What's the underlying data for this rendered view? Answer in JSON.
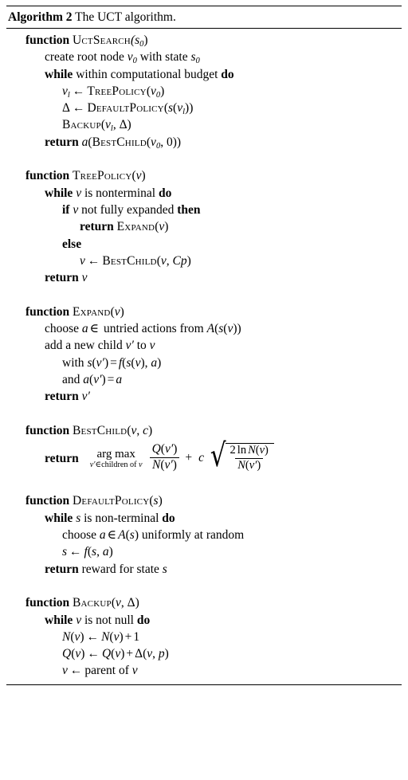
{
  "caption": {
    "label": "Algorithm",
    "number": "2",
    "title": "The UCT algorithm."
  },
  "lines": {
    "f1_header_kw": "function",
    "f1_header_name": "UctSearch",
    "f1_header_args": "(s",
    "f1_header_sub": "0",
    "f1_header_close": ")",
    "f1_l1_a": "create root node ",
    "f1_l1_v": "v",
    "f1_l1_vsub": "0",
    "f1_l1_b": " with state ",
    "f1_l1_s": "s",
    "f1_l1_ssub": "0",
    "f1_l2_kw1": "while",
    "f1_l2_text": "within computational budget",
    "f1_l2_kw2": "do",
    "f1_l3_v": "v",
    "f1_l3_vsub": "l",
    "f1_l3_arrow": "←",
    "f1_l3_call": "TreePolicy",
    "f1_l3_open": "(",
    "f1_l3_arg": "v",
    "f1_l3_argsub": "0",
    "f1_l3_close": ")",
    "f1_l4_delta": "Δ",
    "f1_l4_arrow": "←",
    "f1_l4_call": "DefaultPolicy",
    "f1_l4_open": "(",
    "f1_l4_s": "s",
    "f1_l4_open2": "(",
    "f1_l4_v": "v",
    "f1_l4_vsub": "l",
    "f1_l4_close": "))",
    "f1_l5_call": "Backup",
    "f1_l5_open": "(",
    "f1_l5_v": "v",
    "f1_l5_vsub": "l",
    "f1_l5_comma": ", ",
    "f1_l5_delta": "Δ",
    "f1_l5_close": ")",
    "f1_l6_kw": "return",
    "f1_l6_a": "a",
    "f1_l6_open": "(",
    "f1_l6_call": "BestChild",
    "f1_l6_open2": "(",
    "f1_l6_v": "v",
    "f1_l6_vsub": "0",
    "f1_l6_comma": ", ",
    "f1_l6_zero": "0",
    "f1_l6_close": "))",
    "f2_header_kw": "function",
    "f2_header_name": "TreePolicy",
    "f2_header_open": "(",
    "f2_header_v": "v",
    "f2_header_close": ")",
    "f2_l1_kw1": "while",
    "f2_l1_v": "v",
    "f2_l1_text": "is nonterminal",
    "f2_l1_kw2": "do",
    "f2_l2_kw1": "if",
    "f2_l2_v": "v",
    "f2_l2_text": "not fully expanded",
    "f2_l2_kw2": "then",
    "f2_l3_kw": "return",
    "f2_l3_call": "Expand",
    "f2_l3_open": "(",
    "f2_l3_v": "v",
    "f2_l3_close": ")",
    "f2_l4_kw": "else",
    "f2_l5_v": "v",
    "f2_l5_arrow": "←",
    "f2_l5_call": "BestChild",
    "f2_l5_open": "(",
    "f2_l5_arg1": "v",
    "f2_l5_comma": ", ",
    "f2_l5_arg2": "Cp",
    "f2_l5_close": ")",
    "f2_l6_kw": "return",
    "f2_l6_v": "v",
    "f3_header_kw": "function",
    "f3_header_name": "Expand",
    "f3_header_open": "(",
    "f3_header_v": "v",
    "f3_header_close": ")",
    "f3_l1_a": "choose ",
    "f3_l1_var": "a",
    "f3_l1_in": "∈",
    "f3_l1_b": " untried actions from ",
    "f3_l1_A": "A",
    "f3_l1_open": "(",
    "f3_l1_s": "s",
    "f3_l1_open2": "(",
    "f3_l1_v": "v",
    "f3_l1_close": "))",
    "f3_l2_a": "add a new child ",
    "f3_l2_vp": "v′",
    "f3_l2_b": " to ",
    "f3_l2_v": "v",
    "f3_l3_kw": "with ",
    "f3_l3_s": "s",
    "f3_l3_open": "(",
    "f3_l3_vp": "v′",
    "f3_l3_close": ")",
    "f3_l3_eq": "=",
    "f3_l3_f": "f",
    "f3_l3_open2": "(",
    "f3_l3_s2": "s",
    "f3_l3_open3": "(",
    "f3_l3_v": "v",
    "f3_l3_close2": ")",
    "f3_l3_comma": ", ",
    "f3_l3_a": "a",
    "f3_l3_close3": ")",
    "f3_l4_kw": "and  ",
    "f3_l4_a": "a",
    "f3_l4_open": "(",
    "f3_l4_vp": "v′",
    "f3_l4_close": ")",
    "f3_l4_eq": "=",
    "f3_l4_a2": "a",
    "f3_l5_kw": "return",
    "f3_l5_vp": "v′",
    "f4_header_kw": "function",
    "f4_header_name": "BestChild",
    "f4_header_open": "(",
    "f4_header_v": "v",
    "f4_header_comma": ", ",
    "f4_header_c": "c",
    "f4_header_close": ")",
    "f4_return_kw": "return",
    "f4_argmax_top": "arg max",
    "f4_argmax_bot_vp": "v′",
    "f4_argmax_bot_in": "∈",
    "f4_argmax_bot_text": "children of ",
    "f4_argmax_bot_v": "v",
    "f4_frac1_num_Q": "Q",
    "f4_frac1_num_open": "(",
    "f4_frac1_num_vp": "v′",
    "f4_frac1_num_close": ")",
    "f4_frac1_den_N": "N",
    "f4_frac1_den_open": "(",
    "f4_frac1_den_vp": "v′",
    "f4_frac1_den_close": ")",
    "f4_plus": "+",
    "f4_c": "c",
    "f4_sqrt_glyph": "√",
    "f4_frac2_num_2": "2",
    "f4_frac2_num_ln": "ln",
    "f4_frac2_num_N": "N",
    "f4_frac2_num_open": "(",
    "f4_frac2_num_v": "v",
    "f4_frac2_num_close": ")",
    "f4_frac2_den_N": "N",
    "f4_frac2_den_open": "(",
    "f4_frac2_den_vp": "v′",
    "f4_frac2_den_close": ")",
    "f5_header_kw": "function",
    "f5_header_name": "DefaultPolicy",
    "f5_header_open": "(",
    "f5_header_s": "s",
    "f5_header_close": ")",
    "f5_l1_kw1": "while",
    "f5_l1_s": "s",
    "f5_l1_text": "is non-terminal",
    "f5_l1_kw2": "do",
    "f5_l2_a": "choose ",
    "f5_l2_var": "a",
    "f5_l2_in": "∈",
    "f5_l2_A": "A",
    "f5_l2_open": "(",
    "f5_l2_s": "s",
    "f5_l2_close": ")",
    "f5_l2_b": " uniformly at random",
    "f5_l3_s": "s",
    "f5_l3_arrow": "←",
    "f5_l3_f": "f",
    "f5_l3_open": "(",
    "f5_l3_s2": "s",
    "f5_l3_comma": ", ",
    "f5_l3_a": "a",
    "f5_l3_close": ")",
    "f5_l4_kw": "return",
    "f5_l4_text": "reward for state ",
    "f5_l4_s": "s",
    "f6_header_kw": "function",
    "f6_header_name": "Backup",
    "f6_header_open": "(",
    "f6_header_v": "v",
    "f6_header_comma": ", ",
    "f6_header_delta": "Δ",
    "f6_header_close": ")",
    "f6_l1_kw1": "while",
    "f6_l1_v": "v",
    "f6_l1_text": "is not null",
    "f6_l1_kw2": "do",
    "f6_l2_N": "N",
    "f6_l2_open": "(",
    "f6_l2_v": "v",
    "f6_l2_close": ")",
    "f6_l2_arrow": "←",
    "f6_l2_N2": "N",
    "f6_l2_open2": "(",
    "f6_l2_v2": "v",
    "f6_l2_close2": ")",
    "f6_l2_plus": "+",
    "f6_l2_one": "1",
    "f6_l3_Q": "Q",
    "f6_l3_open": "(",
    "f6_l3_v": "v",
    "f6_l3_close": ")",
    "f6_l3_arrow": "←",
    "f6_l3_Q2": "Q",
    "f6_l3_open2": "(",
    "f6_l3_v2": "v",
    "f6_l3_close2": ")",
    "f6_l3_plus": "+",
    "f6_l3_delta": "Δ",
    "f6_l3_open3": "(",
    "f6_l3_v3": "v",
    "f6_l3_comma": ", ",
    "f6_l3_p": "p",
    "f6_l3_close3": ")",
    "f6_l4_v": "v",
    "f6_l4_arrow": "←",
    "f6_l4_text": "parent of ",
    "f6_l4_v2": "v"
  }
}
